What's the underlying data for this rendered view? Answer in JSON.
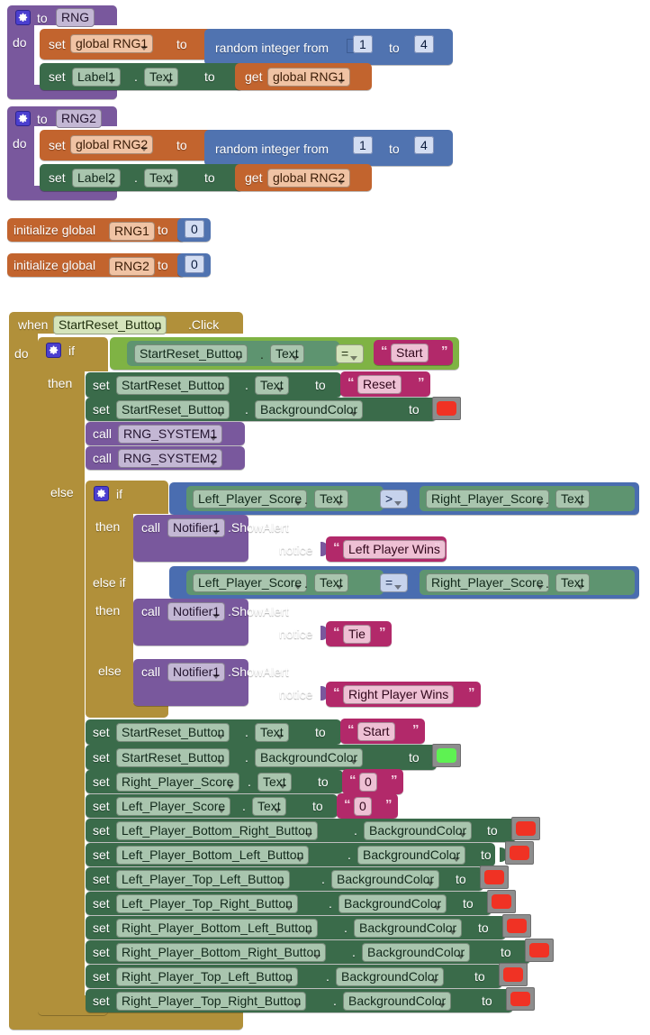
{
  "app": {
    "editor": "MIT App Inventor Blocks Editor",
    "canvas_background": "#ffffff"
  },
  "palette": {
    "procedure_purple": "#79589d",
    "variable_orange": "#c2642e",
    "setter_green": "#3a6b4a",
    "event_gold": "#b1903a",
    "control_gold": "#b1903a",
    "logic_ltgreen": "#7fb344",
    "math_blue": "#5073b0",
    "comparison_blue": "#4a6db0",
    "text_magenta": "#b2296a",
    "color_red": "#f03224",
    "color_green": "#5ef252",
    "swatch_frame": "#8d8d8d"
  },
  "procedures": [
    {
      "id": "proc-rng",
      "gear_icon": "gear-icon",
      "to_label": "to",
      "name": "RNG",
      "do_label": "do",
      "statements": [
        {
          "kind": "set-global",
          "set_label": "set",
          "variable": "global RNG1",
          "to_label": "to",
          "value": {
            "kind": "random-integer",
            "label": "random integer from",
            "from": "1",
            "mid_label": "to",
            "to": "4"
          }
        },
        {
          "kind": "set-component",
          "set_label": "set",
          "component": "Label1",
          "dot": ".",
          "property": "Text",
          "to_label": "to",
          "value": {
            "kind": "get-global",
            "get_label": "get",
            "variable": "global RNG1"
          }
        }
      ]
    },
    {
      "id": "proc-rng2",
      "gear_icon": "gear-icon",
      "to_label": "to",
      "name": "RNG2",
      "do_label": "do",
      "statements": [
        {
          "kind": "set-global",
          "set_label": "set",
          "variable": "global RNG2",
          "to_label": "to",
          "value": {
            "kind": "random-integer",
            "label": "random integer from",
            "from": "1",
            "mid_label": "to",
            "to": "4"
          }
        },
        {
          "kind": "set-component",
          "set_label": "set",
          "component": "Label2",
          "dot": ".",
          "property": "Text",
          "to_label": "to",
          "value": {
            "kind": "get-global",
            "get_label": "get",
            "variable": "global RNG2"
          }
        }
      ]
    }
  ],
  "globals": [
    {
      "prefix": "initialize global",
      "name": "RNG1",
      "to_label": "to",
      "value": "0"
    },
    {
      "prefix": "initialize global",
      "name": "RNG2",
      "to_label": "to",
      "value": "0"
    }
  ],
  "event": {
    "when_label": "when",
    "component": "StartReset_Button",
    "event_name": ".Click",
    "do_label": "do",
    "outer_if": {
      "gear_icon": "gear-icon",
      "if_label": "if",
      "then_label": "then",
      "else_label": "else",
      "condition": {
        "left_component": "StartReset_Button",
        "left_dot": ".",
        "left_property": "Text",
        "operator": "=",
        "right_text": "Start"
      },
      "then_statements": [
        {
          "set_label": "set",
          "component": "StartReset_Button",
          "dot": ".",
          "property": "Text",
          "to_label": "to",
          "value_type": "text",
          "value": "Reset"
        },
        {
          "set_label": "set",
          "component": "StartReset_Button",
          "dot": ".",
          "property": "BackgroundColor",
          "to_label": "to",
          "value_type": "color",
          "value": "#f03224"
        },
        {
          "call_label": "call",
          "procedure": "RNG_SYSTEM1"
        },
        {
          "call_label": "call",
          "procedure": "RNG_SYSTEM2"
        }
      ]
    },
    "inner_if": {
      "gear_icon": "gear-icon",
      "if_label": "if",
      "then_label": "then",
      "else_if_label": "else if",
      "else_label": "else",
      "branch1": {
        "condition": {
          "left_component": "Left_Player_Score",
          "left_dot": ".",
          "left_property": "Text",
          "operator": ">",
          "right_component": "Right_Player_Score",
          "right_dot": ".",
          "right_property": "Text"
        },
        "action": {
          "call_label": "call",
          "component": "Notifier1",
          "method": ".ShowAlert",
          "arg_label": "notice",
          "arg_text": "Left Player Wins"
        }
      },
      "branch2": {
        "condition": {
          "left_component": "Left_Player_Score",
          "left_dot": ".",
          "left_property": "Text",
          "operator": "=",
          "right_component": "Right_Player_Score",
          "right_dot": ".",
          "right_property": "Text"
        },
        "action": {
          "call_label": "call",
          "component": "Notifier1",
          "method": ".ShowAlert",
          "arg_label": "notice",
          "arg_text": "Tie"
        }
      },
      "branch3": {
        "action": {
          "call_label": "call",
          "component": "Notifier1",
          "method": ".ShowAlert",
          "arg_label": "notice",
          "arg_text": "Right Player Wins"
        }
      }
    },
    "reset_statements": [
      {
        "set_label": "set",
        "component": "StartReset_Button",
        "dot": ".",
        "property": "Text",
        "to_label": "to",
        "value_type": "text",
        "value": "Start"
      },
      {
        "set_label": "set",
        "component": "StartReset_Button",
        "dot": ".",
        "property": "BackgroundColor",
        "to_label": "to",
        "value_type": "color",
        "value": "#5ef252"
      },
      {
        "set_label": "set",
        "component": "Right_Player_Score",
        "dot": ".",
        "property": "Text",
        "to_label": "to",
        "value_type": "text",
        "value": "0"
      },
      {
        "set_label": "set",
        "component": "Left_Player_Score",
        "dot": ".",
        "property": "Text",
        "to_label": "to",
        "value_type": "text",
        "value": "0"
      },
      {
        "set_label": "set",
        "component": "Left_Player_Bottom_Right_Button",
        "dot": ".",
        "property": "BackgroundColor",
        "to_label": "to",
        "value_type": "color",
        "value": "#f03224"
      },
      {
        "set_label": "set",
        "component": "Left_Player_Bottom_Left_Button",
        "dot": ".",
        "property": "BackgroundColor",
        "to_label": "to",
        "value_type": "color",
        "value": "#f03224"
      },
      {
        "set_label": "set",
        "component": "Left_Player_Top_Left_Button",
        "dot": ".",
        "property": "BackgroundColor",
        "to_label": "to",
        "value_type": "color",
        "value": "#f03224"
      },
      {
        "set_label": "set",
        "component": "Left_Player_Top_Right_Button",
        "dot": ".",
        "property": "BackgroundColor",
        "to_label": "to",
        "value_type": "color",
        "value": "#f03224"
      },
      {
        "set_label": "set",
        "component": "Right_Player_Bottom_Left_Button",
        "dot": ".",
        "property": "BackgroundColor",
        "to_label": "to",
        "value_type": "color",
        "value": "#f03224"
      },
      {
        "set_label": "set",
        "component": "Right_Player_Bottom_Right_Button",
        "dot": ".",
        "property": "BackgroundColor",
        "to_label": "to",
        "value_type": "color",
        "value": "#f03224"
      },
      {
        "set_label": "set",
        "component": "Right_Player_Top_Left_Button",
        "dot": ".",
        "property": "BackgroundColor",
        "to_label": "to",
        "value_type": "color",
        "value": "#f03224"
      },
      {
        "set_label": "set",
        "component": "Right_Player_Top_Right_Button",
        "dot": ".",
        "property": "BackgroundColor",
        "to_label": "to",
        "value_type": "color",
        "value": "#f03224"
      }
    ]
  }
}
